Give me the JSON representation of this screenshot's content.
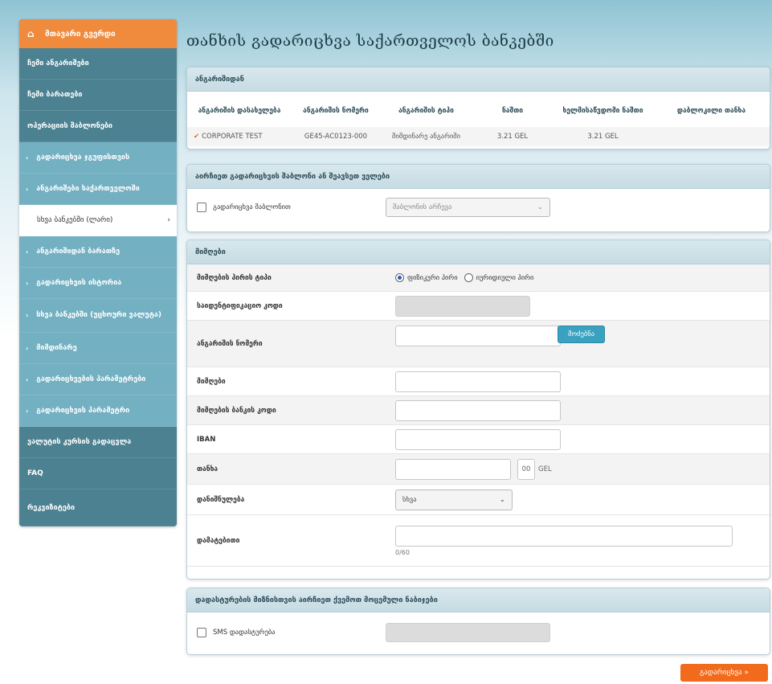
{
  "sidebar": {
    "home_label": "მთავარი გვერდი",
    "items": [
      {
        "label": "ჩემი ანგარიშები"
      },
      {
        "label": "ჩემი ბარათები"
      },
      {
        "label": "ოპერაციის შაბლონები"
      },
      {
        "label": "გადარიცხვა ჯგუფისთვის"
      },
      {
        "label": "ანგარიშები საქართველოში"
      },
      {
        "label": "სხვა ბანკებში (ლარი)"
      },
      {
        "label": "ანგარიშიდან ბარათზე"
      },
      {
        "label": "გადარიცხვის ისტორია"
      },
      {
        "label": "სხვა ბანკებში (უცხოური ვალუტა)"
      },
      {
        "label": "მიმდინარე"
      },
      {
        "label": "გადარიცხვების პარამეტრები"
      },
      {
        "label": "გადარიცხვის პარამეტრი"
      },
      {
        "label": "ვალუტის კურსის გადაცვლა"
      },
      {
        "label": "FAQ"
      },
      {
        "label": "რეკვიზიტები"
      }
    ]
  },
  "page_title": "თანხის გადარიცხვა საქართველოს ბანკებში",
  "account_panel": {
    "header": "ანგარიშიდან",
    "columns": [
      "ანგარიშის დასახელება",
      "ანგარიშის ნომერი",
      "ანგარიშის ტიპი",
      "ნაშთი",
      "ხელმისაწვდომი ნაშთი",
      "დაბლოკილი თანხა"
    ],
    "row": {
      "name": "CORPORATE TEST",
      "number": "GE45-AC0123-000",
      "type": "მიმდინარე ანგარიში",
      "balance": "3.21 GEL",
      "available": "3.21 GEL",
      "blocked": ""
    }
  },
  "template_panel": {
    "header": "აირჩიეთ გადარიცხვის შაბლონი ან შეავსეთ ველები",
    "checkbox_label": "გადარიცხვა შაბლონით",
    "select_value": "შაბლონის არჩევა"
  },
  "recipient_panel": {
    "header": "მიმღები",
    "rows": {
      "recipient_type_label": "მიმღების პირის ტიპი",
      "radio_physical": "ფიზიკური პირი",
      "radio_legal": "იურიდიული პირი",
      "tax_code_label": "საიდენტიფიკაციო კოდი",
      "account_label": "ანგარიშის ნომერი",
      "search_button": "მოძებნა",
      "name_label": "მიმღები",
      "bank_label": "მიმღების ბანკის კოდი",
      "iban_label": "IBAN",
      "amount_label": "თანხა",
      "amount_decimal": "00",
      "currency": "GEL",
      "purpose_label": "დანიშნულება",
      "purpose_value": "სხვა",
      "comment_label": "დამატებითი",
      "comment_hint": "0/60"
    }
  },
  "sms_panel": {
    "header": "დადასტურების მიზნისთვის აირჩიეთ ქვემოთ მოცემული ნაბიჯები",
    "checkbox_label": "SMS დადასტურება"
  },
  "submit_label": "გადარიცხვა »"
}
